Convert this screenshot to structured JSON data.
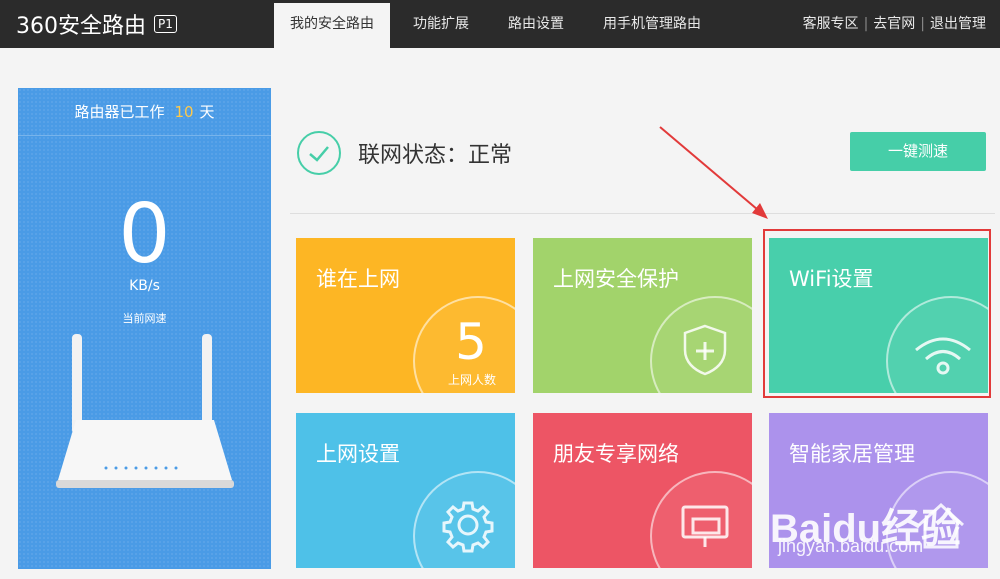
{
  "header": {
    "logo_text": "360安全路由",
    "logo_badge": "P1",
    "tabs": [
      {
        "label": "我的安全路由"
      },
      {
        "label": "功能扩展"
      },
      {
        "label": "路由设置"
      },
      {
        "label": "用手机管理路由"
      }
    ],
    "links": [
      {
        "label": "客服专区"
      },
      {
        "label": "去官网"
      },
      {
        "label": "退出管理"
      }
    ]
  },
  "left_panel": {
    "uptime_prefix": "路由器已工作",
    "uptime_days": "10",
    "uptime_suffix": "天",
    "speed_value": "0",
    "speed_unit": "KB/s",
    "speed_label": "当前网速"
  },
  "status": {
    "text": "联网状态：正常",
    "speedtest_label": "一键测速"
  },
  "tiles": [
    {
      "title": "谁在上网",
      "count": "5",
      "count_label": "上网人数",
      "color": "#fdb624"
    },
    {
      "title": "上网安全保护",
      "icon": "shield-plus-icon",
      "color": "#a2d36b"
    },
    {
      "title": "WiFi设置",
      "icon": "wifi-icon",
      "color": "#48cfab"
    },
    {
      "title": "上网设置",
      "icon": "gear-icon",
      "color": "#4ec1e8"
    },
    {
      "title": "朋友专享网络",
      "icon": "guest-network-icon",
      "color": "#ed5565"
    },
    {
      "title": "智能家居管理",
      "icon": "home-icon",
      "color": "#ac92ec"
    }
  ],
  "colors": {
    "topbar": "#2b2b2b",
    "accent": "#46cea8",
    "left_panel": "#4a9be6",
    "highlight": "#e23a3a"
  },
  "watermark": {
    "logo": "Baidu经验",
    "url": "jingyan.baidu.com"
  }
}
